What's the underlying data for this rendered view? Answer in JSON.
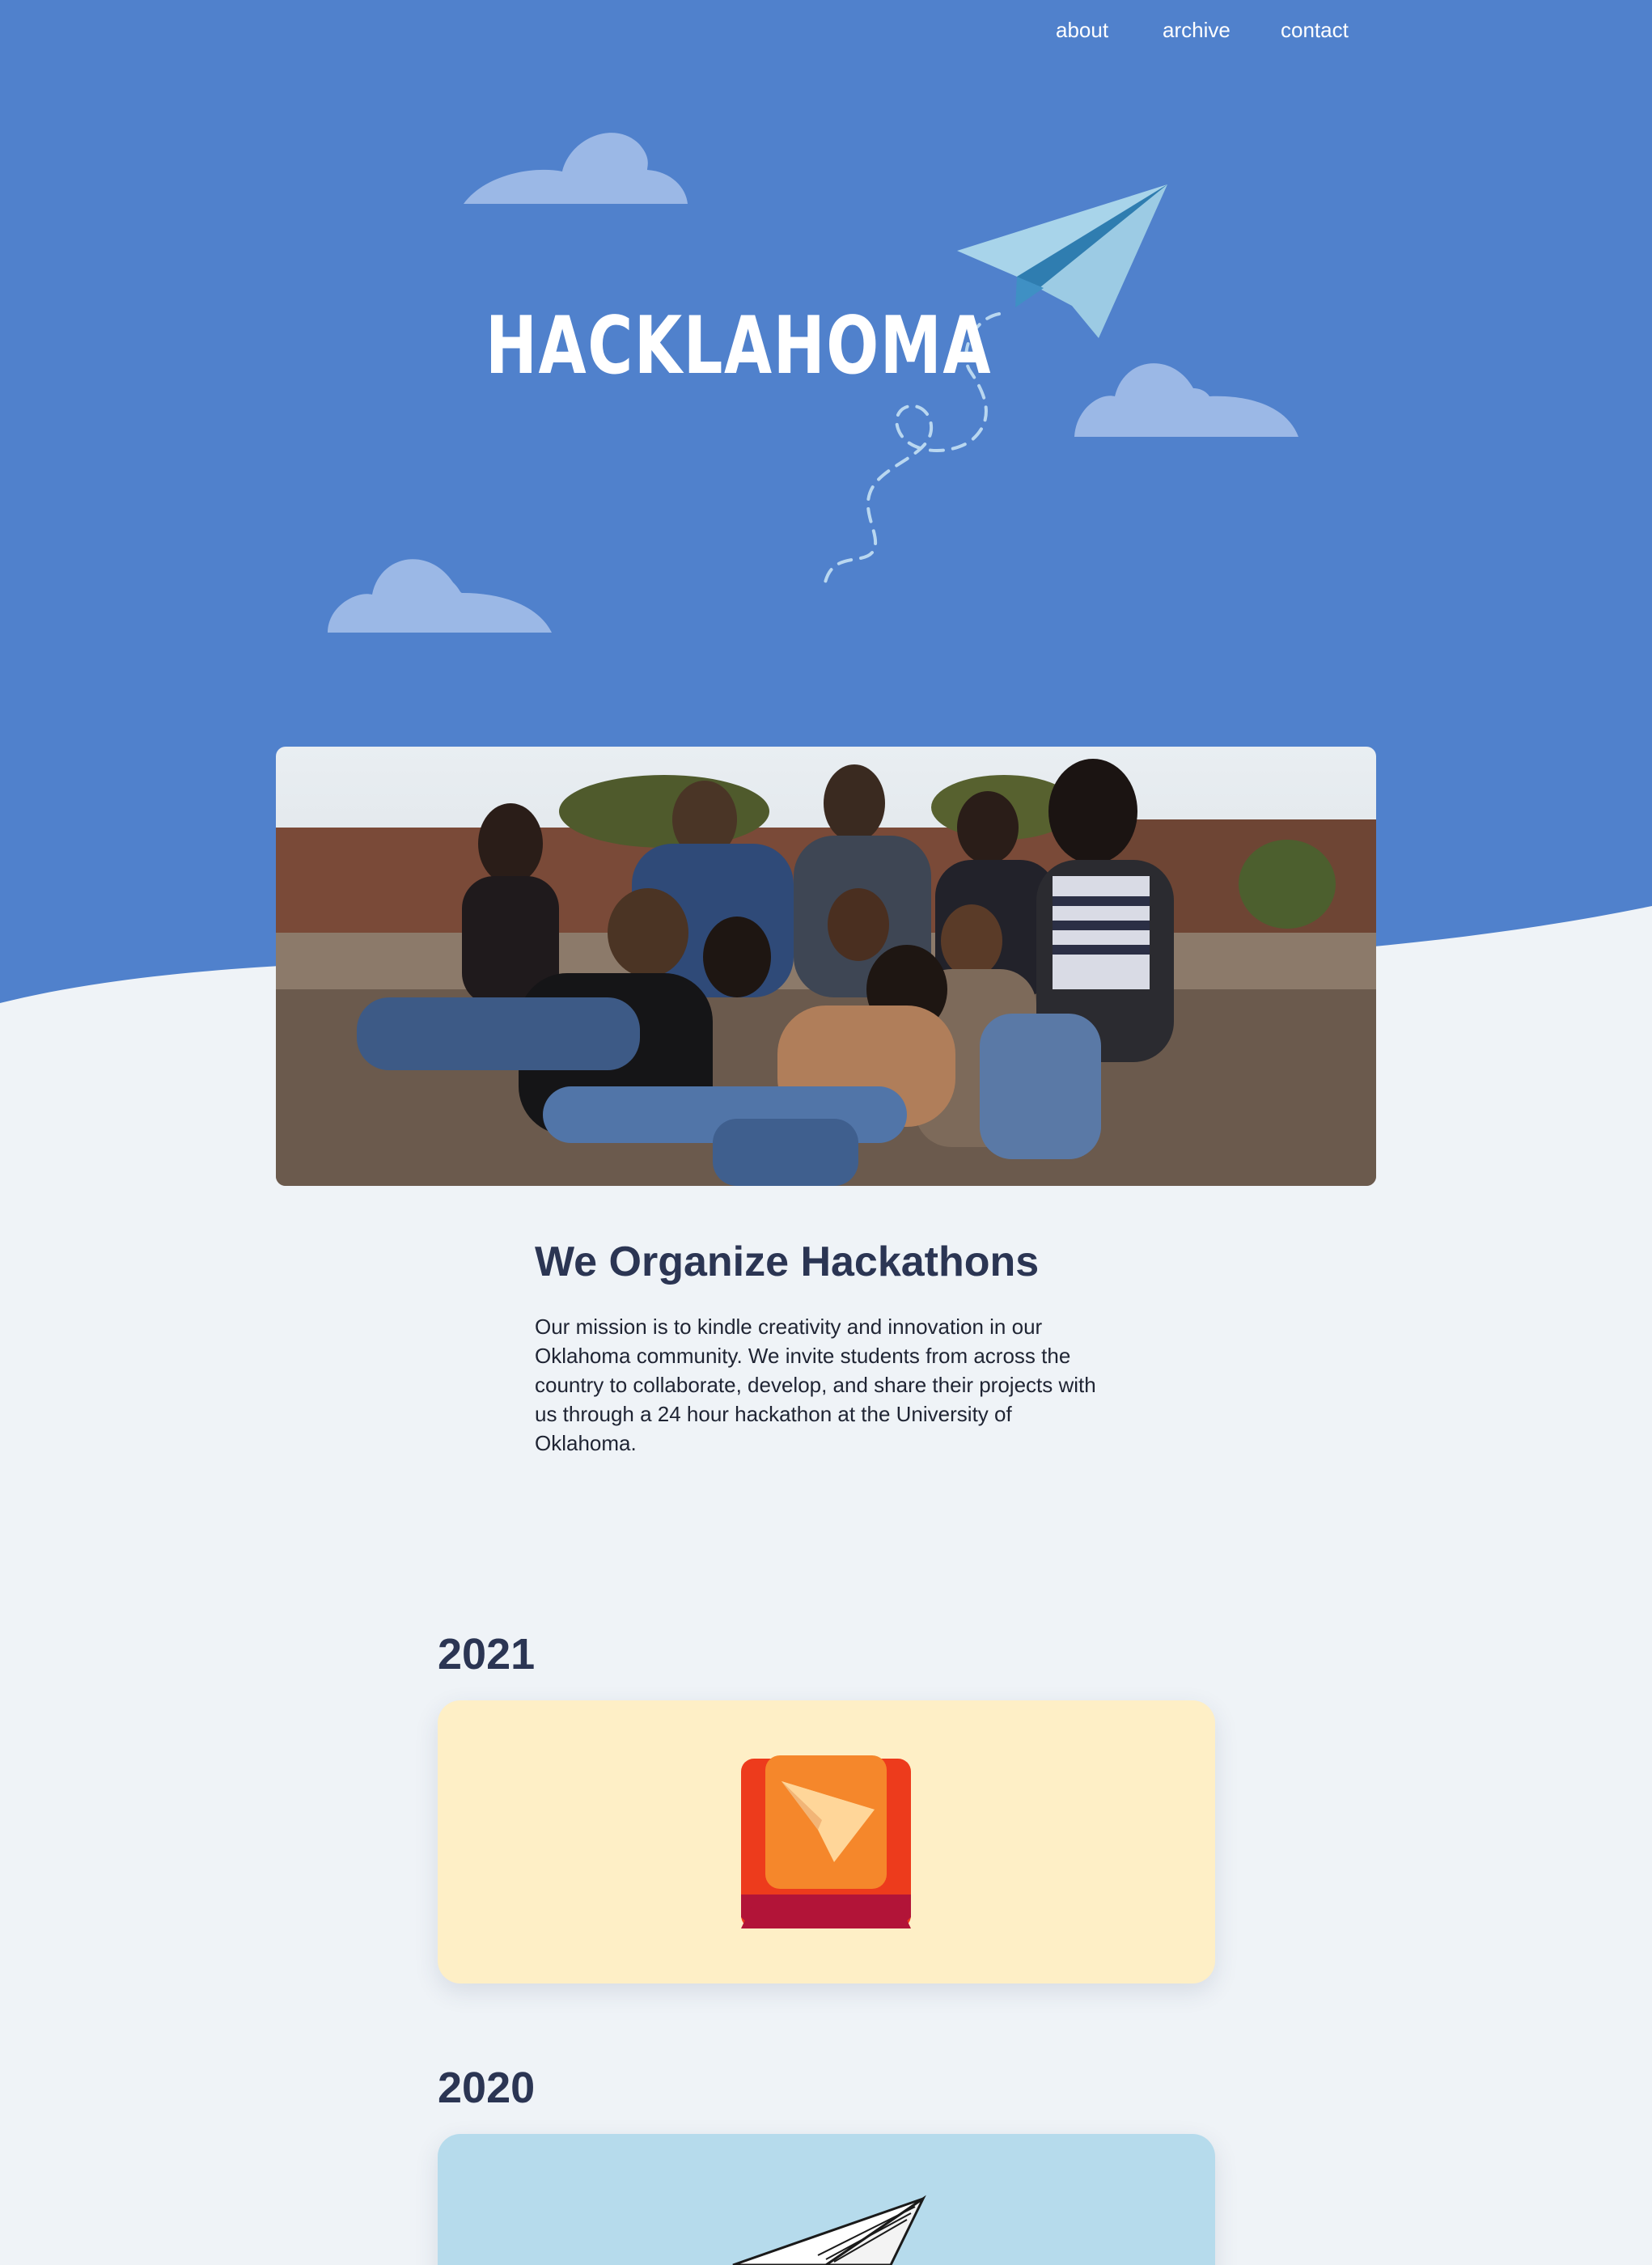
{
  "nav": {
    "items": [
      {
        "label": "about"
      },
      {
        "label": "archive"
      },
      {
        "label": "contact"
      }
    ]
  },
  "hero": {
    "title": "HACKLAHOMA",
    "bg_color": "#5081cc"
  },
  "about": {
    "heading": "We Organize Hackathons",
    "body": "Our mission is to kindle creativity and innovation in our Oklahoma community. We invite students from across the country to collaborate, develop, and share their projects with us through a 24 hour hackathon at the University of Oklahoma."
  },
  "archive": [
    {
      "year": "2021",
      "card_color": "#feefc6",
      "icon": "paper-plane-keycap-icon"
    },
    {
      "year": "2020",
      "card_color": "#b6dbec",
      "icon": "paper-plane-icon"
    }
  ]
}
